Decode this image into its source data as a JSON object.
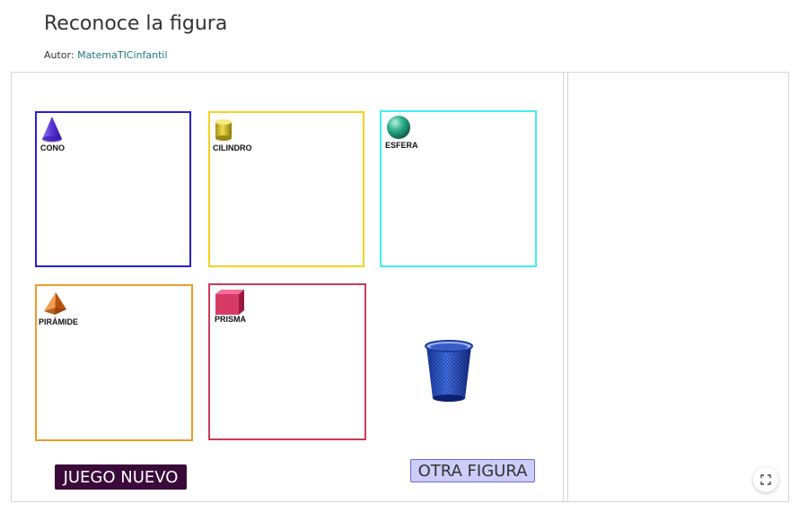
{
  "page": {
    "title": "Reconoce la figura",
    "author_label": "Autor:",
    "author_name": "MatemaTICinfantil"
  },
  "boxes": [
    {
      "label": "CONO",
      "icon": "cone-icon",
      "color": "#2a1fd0"
    },
    {
      "label": "CILINDRO",
      "icon": "cylinder-icon",
      "color": "#f5d21e"
    },
    {
      "label": "ESFERA",
      "icon": "sphere-icon",
      "color": "#3ef0f0"
    },
    {
      "label": "PIRÁMIDE",
      "icon": "pyramid-icon",
      "color": "#f09a28"
    },
    {
      "label": "PRISMA",
      "icon": "prism-icon",
      "color": "#cc3a5a"
    }
  ],
  "buttons": {
    "new_game": "JUEGO NUEVO",
    "new_game_bg": "#3a0a3a",
    "other_figure": "OTRA FIGURA",
    "other_figure_bg": "#cccdfa"
  },
  "icons": {
    "trash": "trash-can-icon",
    "fullscreen": "fullscreen-icon"
  }
}
